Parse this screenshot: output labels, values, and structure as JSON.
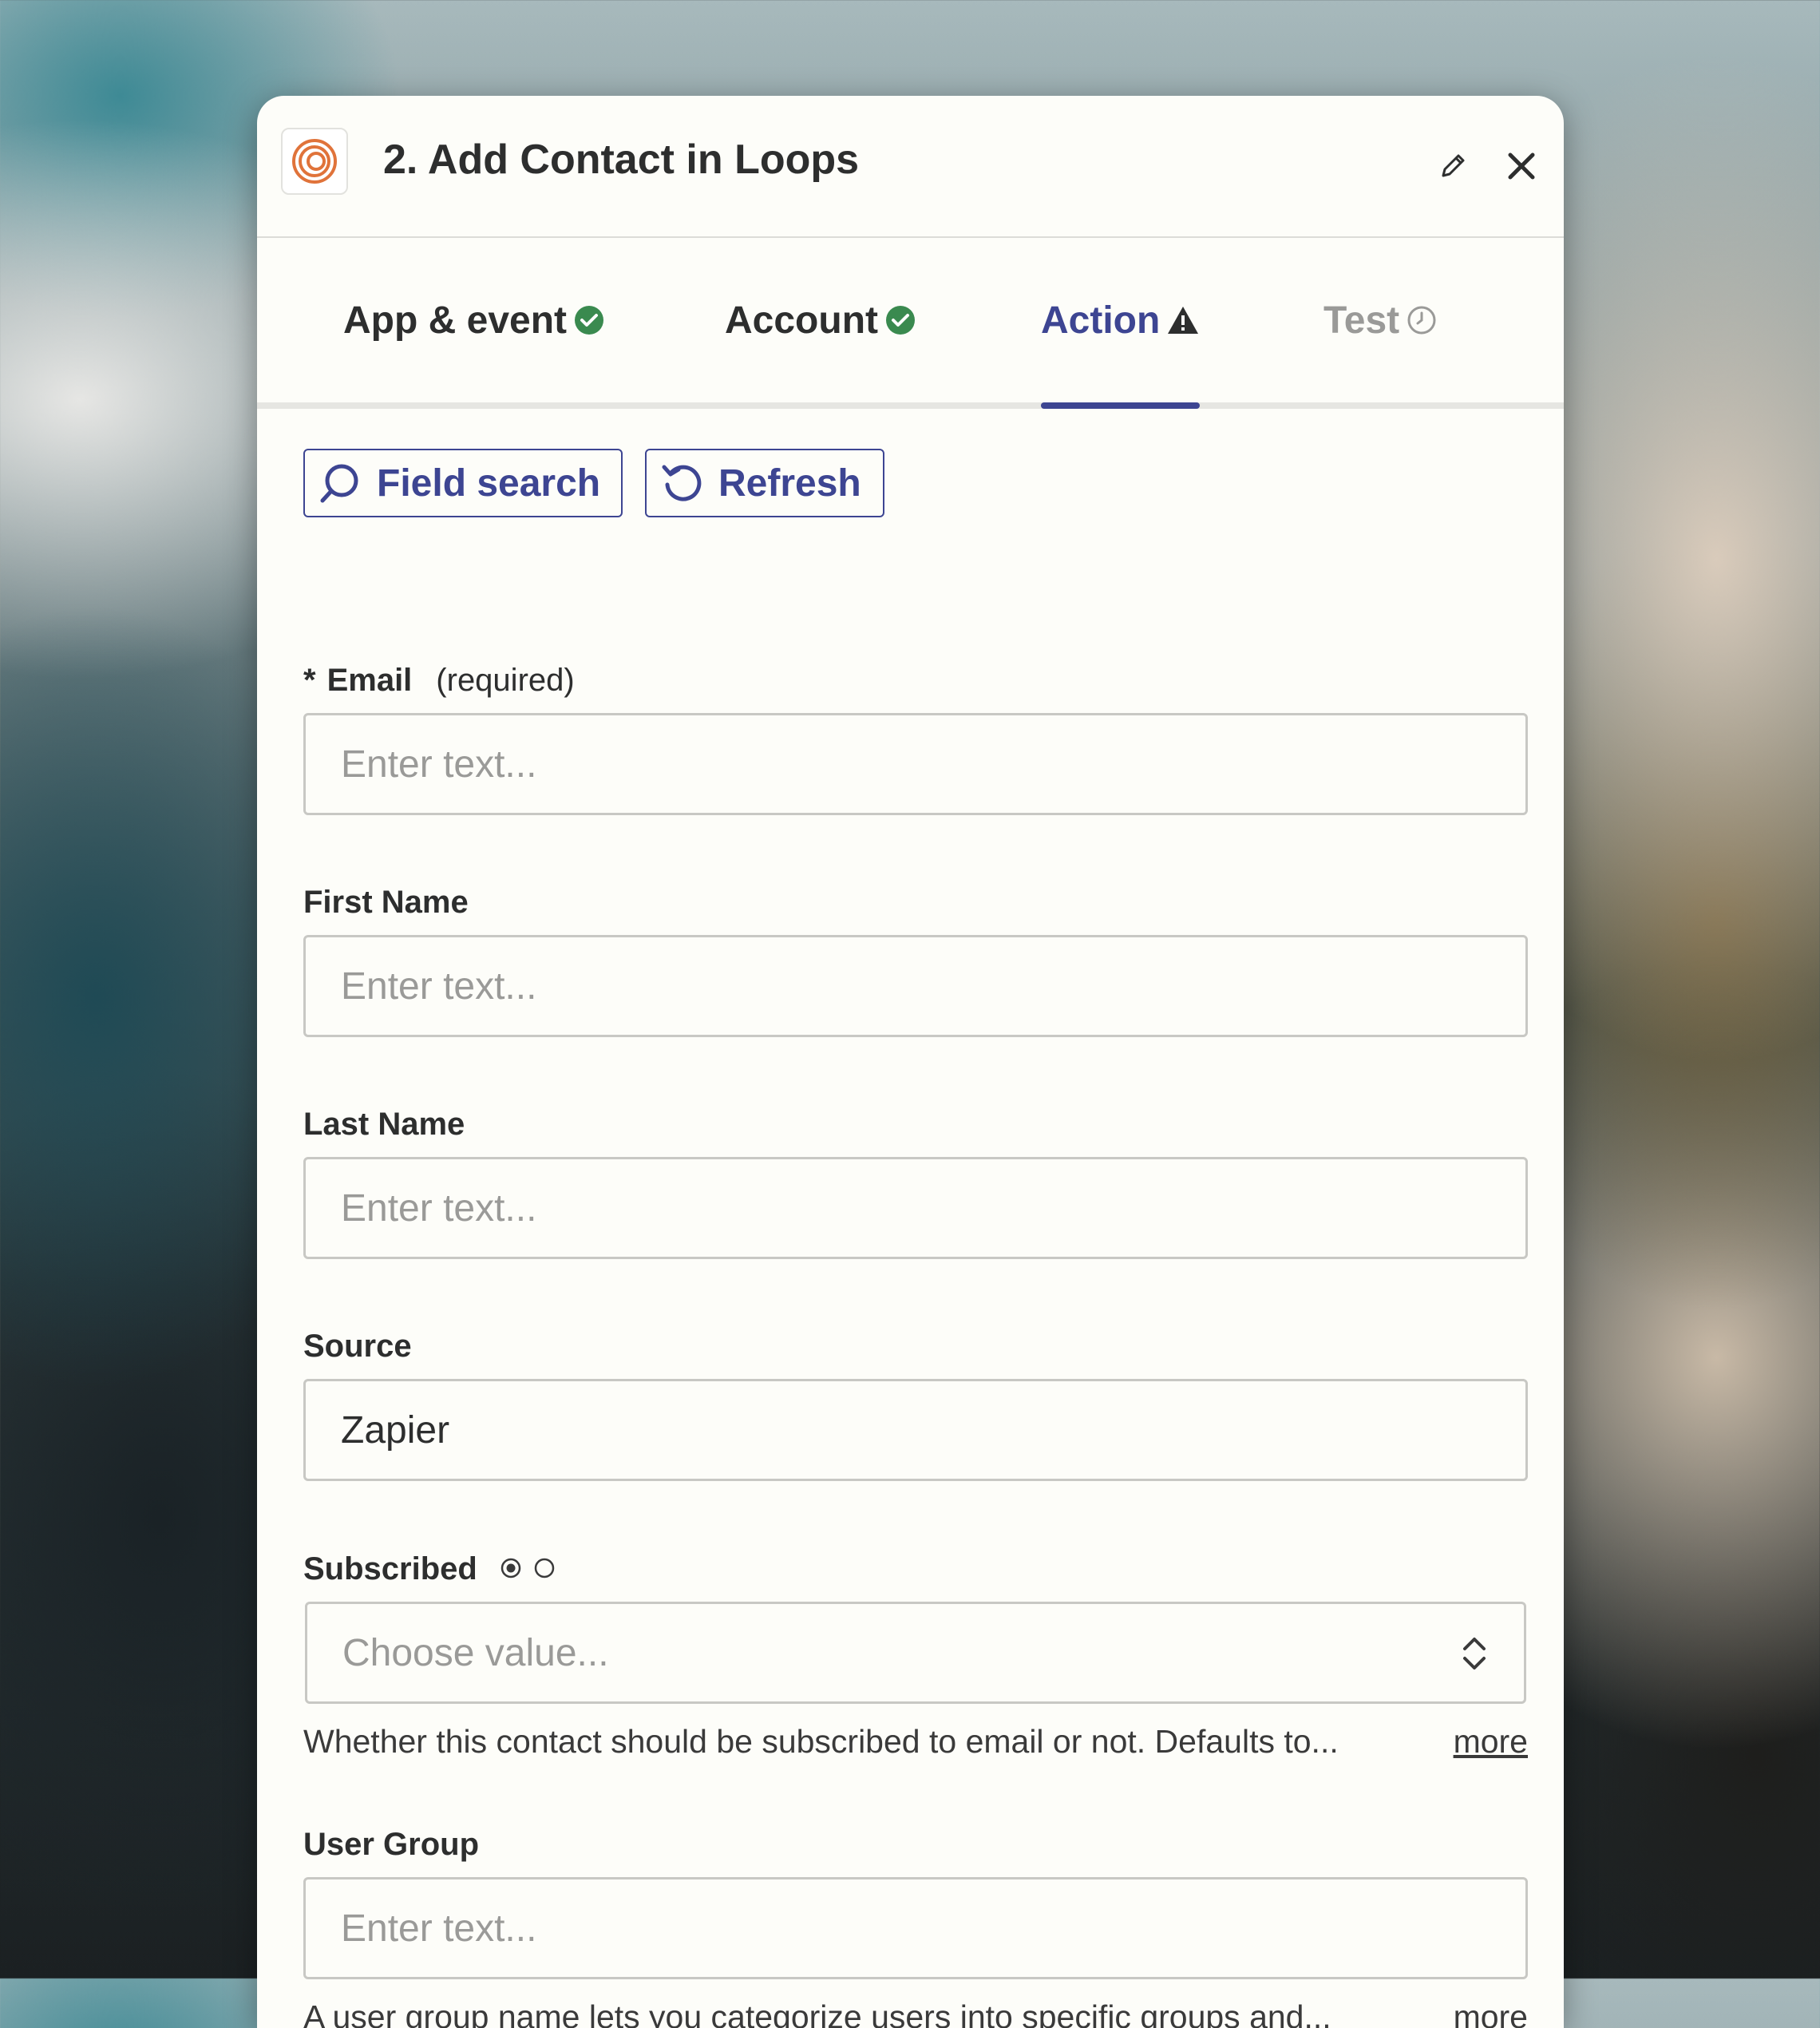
{
  "header": {
    "title": "2. Add Contact in Loops"
  },
  "tabs": [
    {
      "label": "App & event",
      "status": "complete"
    },
    {
      "label": "Account",
      "status": "complete"
    },
    {
      "label": "Action",
      "status": "warning"
    },
    {
      "label": "Test",
      "status": "pending"
    }
  ],
  "toolbar": {
    "field_search_label": "Field search",
    "refresh_label": "Refresh"
  },
  "fields": {
    "email": {
      "required_mark": "*",
      "label": "Email",
      "hint": "(required)",
      "placeholder": "Enter text..."
    },
    "first_name": {
      "label": "First Name",
      "placeholder": "Enter text..."
    },
    "last_name": {
      "label": "Last Name",
      "placeholder": "Enter text..."
    },
    "source": {
      "label": "Source",
      "value": "Zapier"
    },
    "subscribed": {
      "label": "Subscribed",
      "placeholder": "Choose value...",
      "help": "Whether this contact should be subscribed to email or not. Defaults to...",
      "more": "more"
    },
    "user_group": {
      "label": "User Group",
      "placeholder": "Enter text...",
      "help": "A user group name lets you categorize users into specific groups and...",
      "more": "more"
    }
  },
  "colors": {
    "accent": "#3d4592",
    "success": "#3a8a4f",
    "warning": "#2d2e2e",
    "logo": "#e0733a"
  }
}
